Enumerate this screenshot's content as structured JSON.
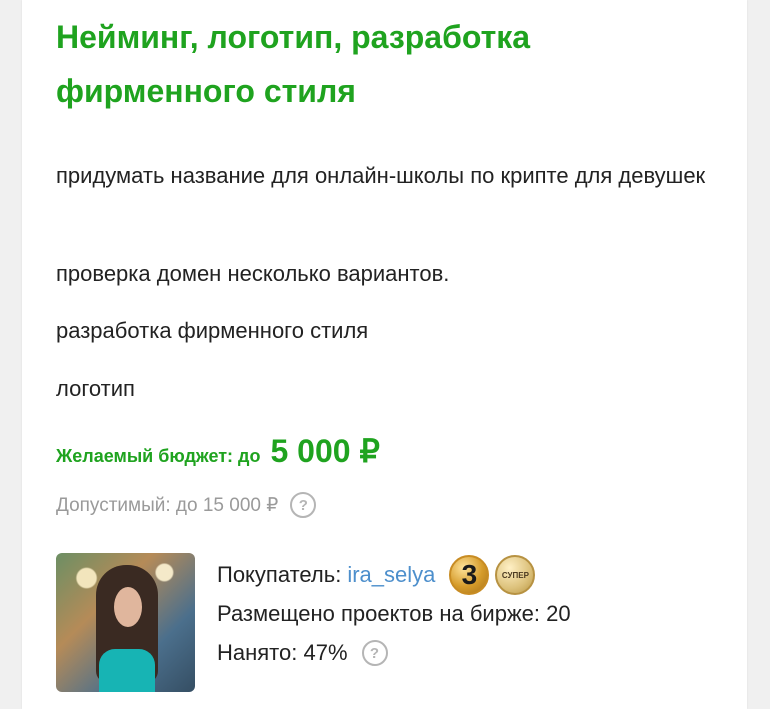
{
  "project": {
    "title": "Нейминг, логотип, разработка фирменного стиля",
    "description": [
      "придумать название для онлайн-школы по крипте для девушек",
      "проверка домен несколько вариантов.",
      "разработка фирменного стиля",
      "логотип"
    ],
    "budget_label": "Желаемый бюджет: до",
    "budget_value": "5 000 ₽",
    "allowed_text": "Допустимый: до 15 000 ₽",
    "help_symbol": "?"
  },
  "buyer": {
    "label": "Покупатель:",
    "name": "ira_selya",
    "level_badge": "3",
    "super_badge": "СУПЕР",
    "projects_text": "Размещено проектов на бирже: 20",
    "hired_text": "Нанято: 47%",
    "help_symbol": "?"
  }
}
